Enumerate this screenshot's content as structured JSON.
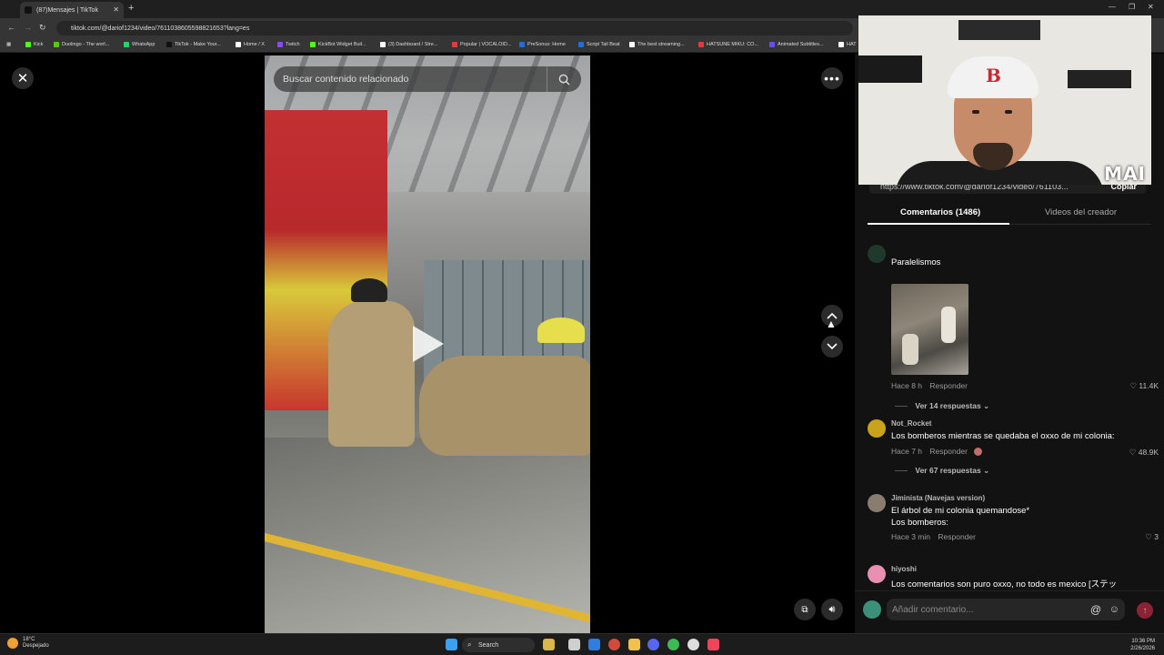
{
  "browser": {
    "tab_title": "(87)Mensajes | TikTok",
    "url": "tiktok.com/@dariof1234/video/7611038605598821653?lang=es",
    "bookmarks": [
      {
        "label": "Kick",
        "color": "#53fc18"
      },
      {
        "label": "Duolingo - The worl...",
        "color": "#58cc02"
      },
      {
        "label": "WhatsApp",
        "color": "#25d366"
      },
      {
        "label": "TikTok - Make Your...",
        "color": "#111111"
      },
      {
        "label": "Home / X",
        "color": "#ffffff"
      },
      {
        "label": "Twitch",
        "color": "#9146ff"
      },
      {
        "label": "KickBot Widget Buil...",
        "color": "#53fc18"
      },
      {
        "label": "(3) Dashboard / Stre...",
        "color": "#ffffff"
      },
      {
        "label": "Popular | VOCALOID...",
        "color": "#e33a3a"
      },
      {
        "label": "PreSonus: Home",
        "color": "#1e6fd9"
      },
      {
        "label": "Script Tail Beat",
        "color": "#1e6fd9"
      },
      {
        "label": "The best streaming...",
        "color": "#ffffff"
      },
      {
        "label": "HATSUNE MIKU: CO...",
        "color": "#e33a3a"
      },
      {
        "label": "Animated Subtitles...",
        "color": "#6a4cf0"
      },
      {
        "label": "HAT",
        "color": "#ffffff"
      }
    ]
  },
  "video": {
    "search_placeholder": "Buscar contenido relacionado"
  },
  "panel": {
    "share_url": "https://www.tiktok.com/@dariof1234/video/761103...",
    "copy_label": "Copiar",
    "tab_comments": "Comentarios (1486)",
    "tab_creator": "Videos del creador",
    "comments": [
      {
        "name": "",
        "text": "Paralelismos",
        "time": "Hace 8 h",
        "reply": "Responder",
        "likes": "11.4K",
        "replies": "Ver 14 respuestas",
        "avatar_color": "#1f3a2c"
      },
      {
        "name": "Not_Rocket",
        "text": "Los bomberos mientras se quedaba el oxxo de mi colonia:",
        "time": "Hace 7 h",
        "reply": "Responder",
        "likes": "48.9K",
        "replies": "Ver 67 respuestas",
        "avatar_color": "#c9a31c"
      },
      {
        "name": "Jiminista (Navejas version)",
        "text": "El árbol de mi colonia quemandose*",
        "text2": "Los bomberos:",
        "time": "Hace 3 min",
        "reply": "Responder",
        "likes": "3",
        "avatar_color": "#8a7d6e"
      },
      {
        "name": "hiyoshi",
        "text": "Los comentarios son puro oxxo, no todo es mexico [ステッ",
        "avatar_color": "#e88fb2"
      }
    ],
    "input_placeholder": "Añadir comentario..."
  },
  "webcam": {
    "tag": "MAI"
  },
  "taskbar": {
    "temp": "18°C",
    "condition": "Despejado",
    "search_label": "Search",
    "time": "10:36 PM",
    "date": "2/26/2026"
  }
}
